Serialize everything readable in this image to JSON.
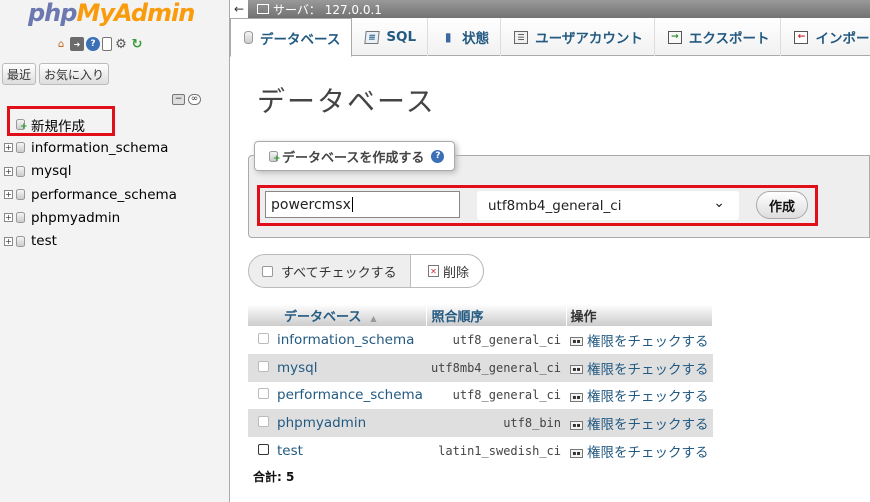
{
  "nav": {
    "logo_php": "php",
    "logo_myadmin": "MyAdmin",
    "icons": [
      "home-icon",
      "exit-icon",
      "help-icon",
      "doc-icon",
      "gear-icon",
      "reload-icon"
    ],
    "recent_label": "最近",
    "favorites_label": "お気に入り",
    "tree": {
      "new_label": "新規作成",
      "databases": [
        "information_schema",
        "mysql",
        "performance_schema",
        "phpmyadmin",
        "test"
      ]
    }
  },
  "topbar": {
    "server_label": "サーバ： 127.0.0.1"
  },
  "tabs": [
    {
      "label": "データベース",
      "icon": "database-icon",
      "active": true
    },
    {
      "label": "SQL",
      "icon": "sql-icon"
    },
    {
      "label": "状態",
      "icon": "status-icon"
    },
    {
      "label": "ユーザアカウント",
      "icon": "users-icon"
    },
    {
      "label": "エクスポート",
      "icon": "export-icon"
    },
    {
      "label": "インポー",
      "icon": "import-icon"
    }
  ],
  "main": {
    "title": "データベース",
    "create": {
      "legend": "データベースを作成する",
      "name_value": "powercmsx",
      "collation_value": "utf8mb4_general_ci",
      "button_label": "作成"
    },
    "check_all_label": "すべてチェックする",
    "delete_label": "削除",
    "table": {
      "headers": {
        "database": "データベース",
        "collation": "照合順序",
        "action": "操作"
      },
      "rows": [
        {
          "name": "information_schema",
          "collation": "utf8_general_ci",
          "action": "権限をチェックする"
        },
        {
          "name": "mysql",
          "collation": "utf8mb4_general_ci",
          "action": "権限をチェックする"
        },
        {
          "name": "performance_schema",
          "collation": "utf8_general_ci",
          "action": "権限をチェックする"
        },
        {
          "name": "phpmyadmin",
          "collation": "utf8_bin",
          "action": "権限をチェックする"
        },
        {
          "name": "test",
          "collation": "latin1_swedish_ci",
          "action": "権限をチェックする"
        }
      ]
    },
    "total_label": "合計: 5"
  },
  "colors": {
    "link": "#235a81",
    "highlight": "#e10f1a",
    "logo_php": "#6c78af",
    "logo_myadmin": "#f89c0e"
  }
}
